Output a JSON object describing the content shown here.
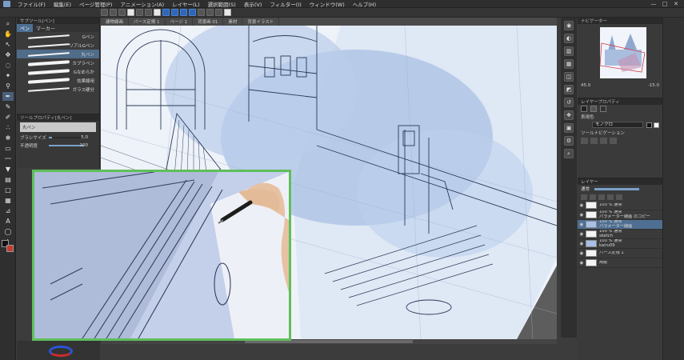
{
  "menu": {
    "items": [
      "ファイル(F)",
      "編集(E)",
      "ページ管理(P)",
      "アニメーション(A)",
      "レイヤー(L)",
      "選択範囲(S)",
      "表示(V)",
      "フィルター(I)",
      "ウィンドウ(W)",
      "ヘルプ(H)"
    ]
  },
  "window_controls": [
    "—",
    "□",
    "✕"
  ],
  "subtool": {
    "header": "サブツール[ペン]",
    "tabs": [
      "ペン",
      "マーカー"
    ],
    "brushes": [
      "Gペン",
      "リアルGペン",
      "丸ペン",
      "カブラペン",
      "Gなめらか",
      "効果線用",
      "ガラス硬分"
    ]
  },
  "tool_property": {
    "header": "ツールプロパティ[丸ペン]",
    "name": "丸ペン",
    "brush_size_label": "ブラシサイズ",
    "brush_size_value": "5.0",
    "opacity_label": "不透明度",
    "opacity_value": "100",
    "opacity_level": 1.0,
    "brush_size_level": 0.1
  },
  "document_tabs": [
    "建物線画",
    "パース定規 1",
    "ページ 1",
    "背景画 01",
    "素材",
    "背景イラスト"
  ],
  "navigator": {
    "header": "ナビゲーター",
    "zoom_value": "45.0",
    "angle_value": "-15.0"
  },
  "layer_property": {
    "header": "レイヤープロパティ",
    "effect_label": "表現色",
    "effect_value": "モノクロ",
    "tool_nav_label": "ツールナビゲーション"
  },
  "layers_panel": {
    "header": "レイヤー",
    "blend_mode": "通常",
    "opacity_level": 1.0,
    "layers": [
      {
        "name": "100 % 通常",
        "sub": "",
        "thumb": "blank",
        "selected": false
      },
      {
        "name": "100 % 通常",
        "sub": "パラメーター線画 のコピー",
        "thumb": "blank",
        "selected": false
      },
      {
        "name": "100 % 通常",
        "sub": "パラメーター線画",
        "thumb": "blue",
        "selected": true
      },
      {
        "name": "100 % 通常",
        "sub": "sketch",
        "thumb": "blank",
        "selected": false
      },
      {
        "name": "100 % 通常",
        "sub": "kairu09",
        "thumb": "blue",
        "selected": false
      },
      {
        "name": "パース定規 1",
        "sub": "",
        "thumb": "blank",
        "selected": false
      },
      {
        "name": "用紙",
        "sub": "",
        "thumb": "blank",
        "selected": false
      }
    ]
  },
  "colors": {
    "pip_border": "#5fbf5a",
    "selection": "#4f6f92",
    "canvas_ink": "#2a3a58",
    "canvas_wash": "#a9c2e4"
  }
}
